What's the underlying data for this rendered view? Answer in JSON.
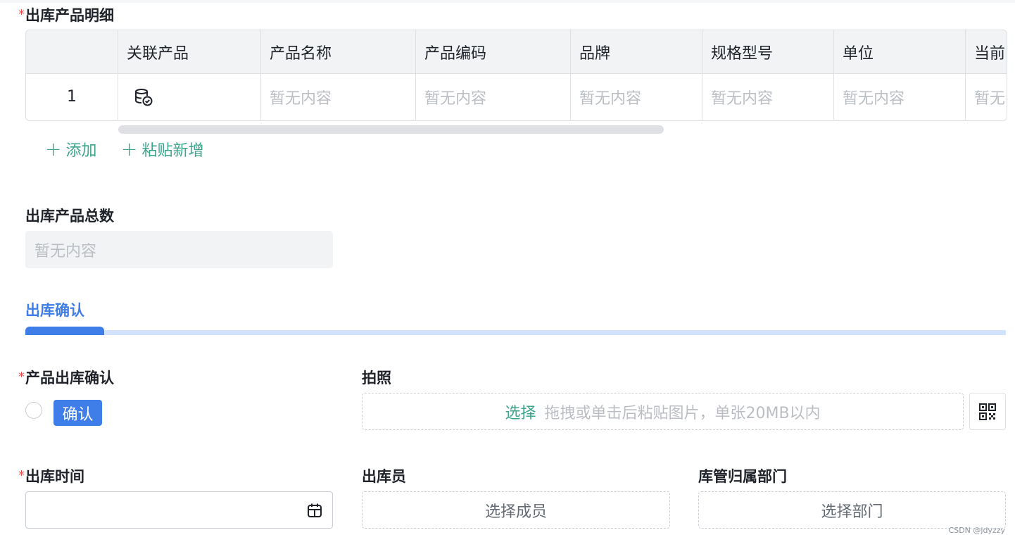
{
  "product_detail": {
    "label": "出库产品明细",
    "columns": [
      "",
      "关联产品",
      "产品名称",
      "产品编码",
      "品牌",
      "规格型号",
      "单位",
      "当前"
    ],
    "rows": [
      {
        "index": "1",
        "linked_icon": "database-check-icon",
        "cells": [
          "暂无内容",
          "暂无内容",
          "暂无内容",
          "暂无内容",
          "暂无内容",
          "暂无内容"
        ]
      }
    ],
    "add_label": "添加",
    "paste_add_label": "粘贴新增"
  },
  "total_count": {
    "label": "出库产品总数",
    "placeholder": "暂无内容"
  },
  "section": {
    "title": "出库确认"
  },
  "confirm": {
    "label": "产品出库确认",
    "option_label": "确认"
  },
  "photo": {
    "label": "拍照",
    "select_text": "选择",
    "hint": "拖拽或单击后粘贴图片，单张20MB以内",
    "qr_icon": "qrcode-icon"
  },
  "out_time": {
    "label": "出库时间",
    "value": "",
    "icon": "calendar-icon"
  },
  "operator": {
    "label": "出库员",
    "placeholder": "选择成员"
  },
  "department": {
    "label": "库管归属部门",
    "placeholder": "选择部门"
  },
  "watermark": "CSDN @jdyzzy",
  "colors": {
    "accent": "#3f7de8",
    "link_green": "#3ca58c",
    "required": "#f54a45",
    "placeholder": "#bbbfc4"
  }
}
